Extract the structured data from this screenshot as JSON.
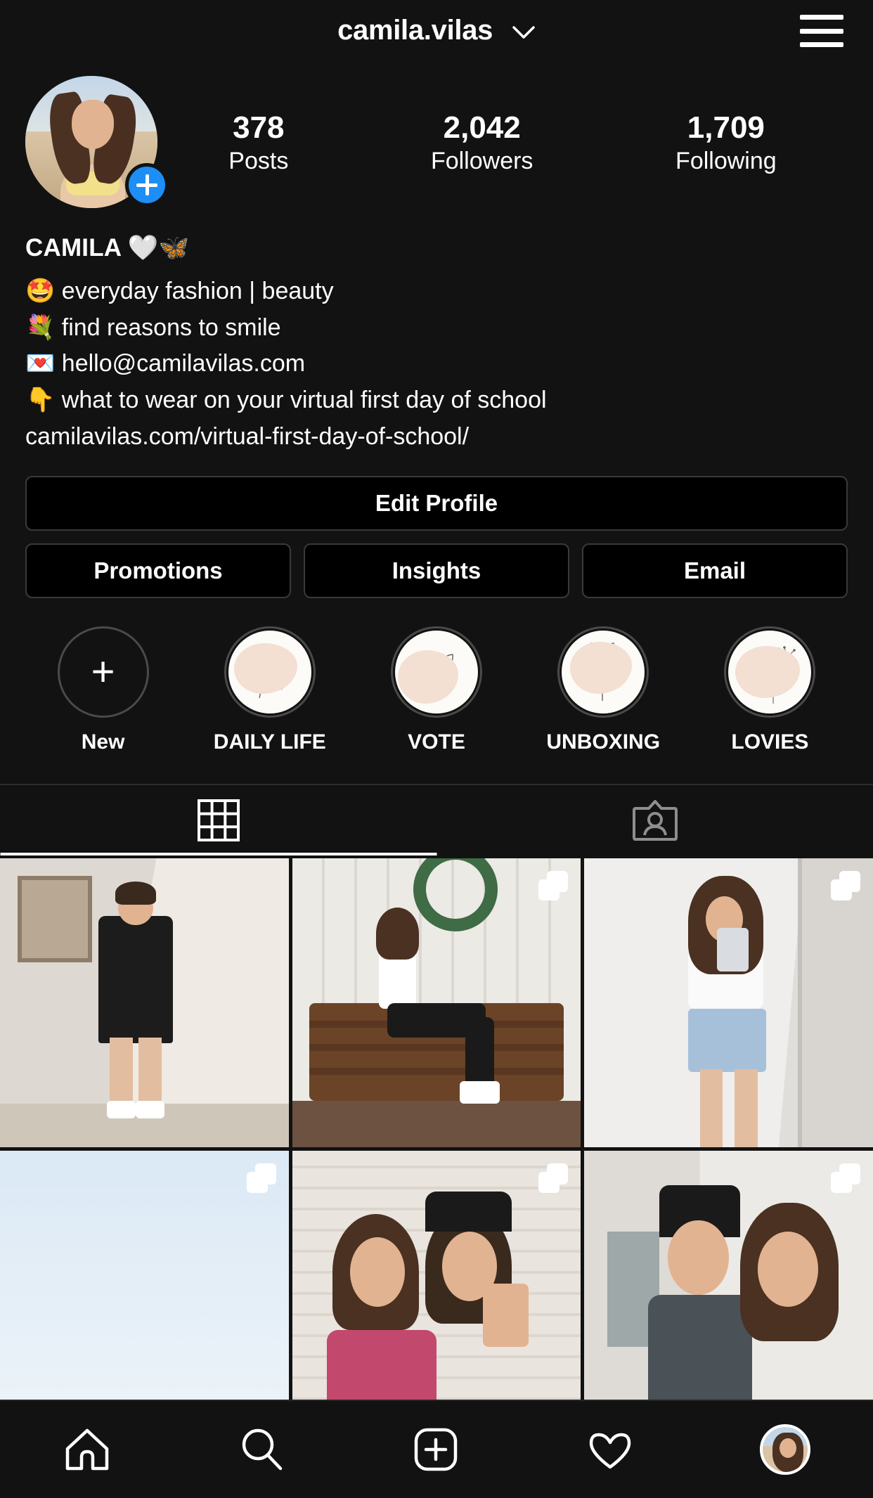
{
  "header": {
    "username": "camila.vilas",
    "chevron_icon": "chevron-down-icon",
    "menu_icon": "hamburger-menu-icon"
  },
  "profile": {
    "avatar_alt": "profile-photo",
    "add_story_icon": "plus-icon",
    "stats": [
      {
        "value": "378",
        "label": "Posts"
      },
      {
        "value": "2,042",
        "label": "Followers"
      },
      {
        "value": "1,709",
        "label": "Following"
      }
    ]
  },
  "bio": {
    "name": "CAMILA 🤍🦋",
    "lines": [
      "🤩 everyday fashion | beauty",
      "💐 find reasons to smile",
      "💌 hello@camilavilas.com",
      "👇 what to wear on your virtual first day of school"
    ],
    "link": "camilavilas.com/virtual-first-day-of-school/"
  },
  "actions": {
    "edit_profile": "Edit Profile",
    "promotions": "Promotions",
    "insights": "Insights",
    "email": "Email"
  },
  "highlights": [
    {
      "label": "New",
      "type": "new",
      "icon": "plus-icon"
    },
    {
      "label": "DAILY LIFE",
      "type": "cover",
      "icon": "leaf-sprig-icon"
    },
    {
      "label": "VOTE",
      "type": "cover",
      "icon": "leaf-branch-icon"
    },
    {
      "label": "UNBOXING",
      "type": "cover",
      "icon": "olive-branch-icon"
    },
    {
      "label": "LOVIES",
      "type": "cover",
      "icon": "dandelion-icon"
    }
  ],
  "tabs": [
    {
      "name": "grid-tab",
      "icon": "grid-icon",
      "active": true
    },
    {
      "name": "tagged-tab",
      "icon": "tagged-person-icon",
      "active": false
    }
  ],
  "grid": [
    {
      "id": "post-1",
      "multi": false,
      "scene": "mirror-selfie-black-tee"
    },
    {
      "id": "post-2",
      "multi": true,
      "scene": "bench-white-wood-wreath"
    },
    {
      "id": "post-3",
      "multi": true,
      "scene": "white-crop-top-denim-shorts"
    },
    {
      "id": "post-4",
      "multi": true,
      "scene": "sky-gradient"
    },
    {
      "id": "post-5",
      "multi": true,
      "scene": "two-friends-brick-wall"
    },
    {
      "id": "post-6",
      "multi": true,
      "scene": "couple-indoor"
    }
  ],
  "bottom_nav": [
    {
      "name": "home-nav",
      "icon": "home-icon"
    },
    {
      "name": "search-nav",
      "icon": "search-icon"
    },
    {
      "name": "create-nav",
      "icon": "plus-square-icon"
    },
    {
      "name": "activity-nav",
      "icon": "heart-icon"
    },
    {
      "name": "profile-nav",
      "icon": "profile-avatar-icon"
    }
  ],
  "colors": {
    "background": "#121212",
    "accent_blue": "#1d8ef5",
    "text": "#ffffff",
    "border": "#3a3a3a",
    "highlight_blob": "#f3e0d2"
  }
}
